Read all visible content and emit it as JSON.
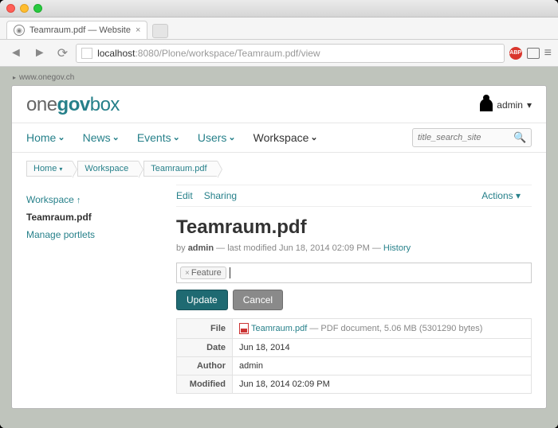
{
  "browser": {
    "tab_title": "Teamraum.pdf — Website",
    "url_host": "localhost",
    "url_path": ":8080/Plone/workspace/Teamraum.pdf/view",
    "abp_label": "ABP"
  },
  "sitelink": "www.onegov.ch",
  "logo": {
    "one": "one",
    "gov": "gov",
    "box": "box"
  },
  "user": {
    "name": "admin",
    "caret": "▾"
  },
  "topnav": {
    "items": [
      "Home",
      "News",
      "Events",
      "Users",
      "Workspace"
    ],
    "search_placeholder": "title_search_site"
  },
  "breadcrumbs": [
    "Home",
    "Workspace",
    "Teamraum.pdf"
  ],
  "sidebar": {
    "up": "Workspace",
    "current": "Teamraum.pdf",
    "manage": "Manage portlets"
  },
  "content_toolbar": {
    "edit": "Edit",
    "sharing": "Sharing",
    "actions": "Actions ▾"
  },
  "title": "Teamraum.pdf",
  "byline": {
    "by": "by",
    "author": "admin",
    "sep": " — last modified ",
    "modified": "Jun 18, 2014 02:09 PM",
    "sep2": " — ",
    "history": "History"
  },
  "tag": "Feature",
  "buttons": {
    "update": "Update",
    "cancel": "Cancel"
  },
  "meta": {
    "file_k": "File",
    "file_name": "Teamraum.pdf",
    "file_desc": " — PDF document, 5.06 MB (5301290 bytes)",
    "date_k": "Date",
    "date_v": "Jun 18, 2014",
    "author_k": "Author",
    "author_v": "admin",
    "modified_k": "Modified",
    "modified_v": "Jun 18, 2014 02:09 PM"
  }
}
